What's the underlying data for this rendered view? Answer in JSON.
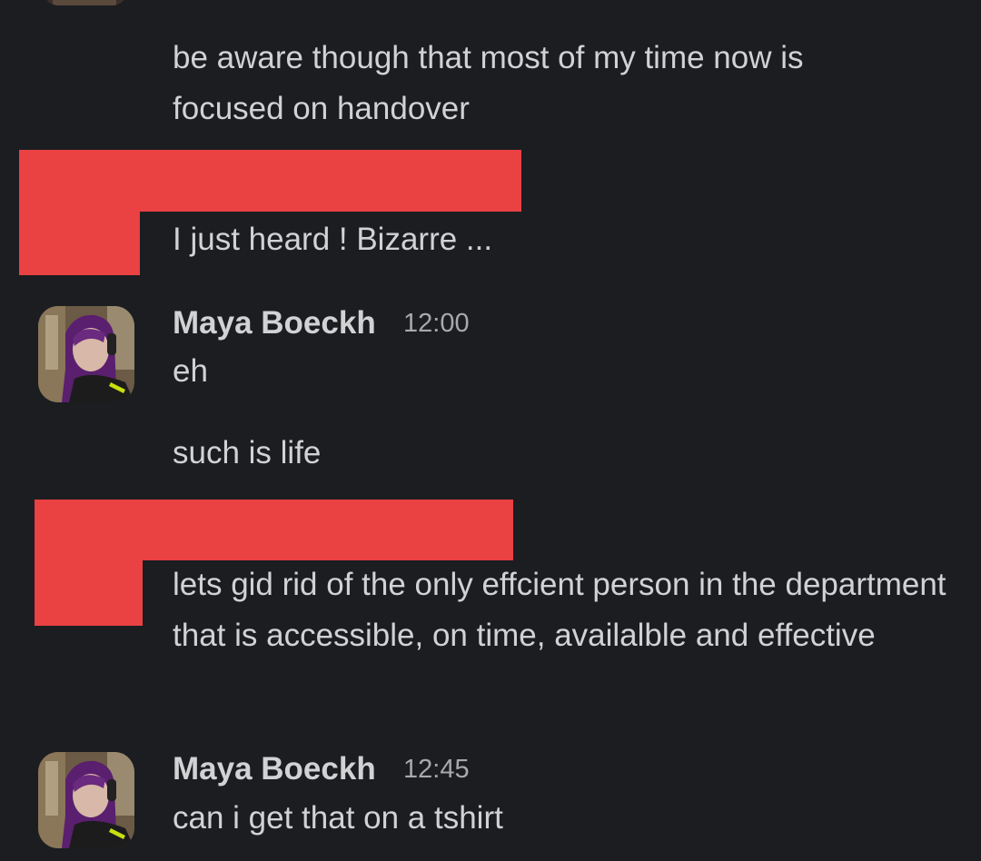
{
  "messages": {
    "m1": "be aware though that most of my time now is focused on handover",
    "m2": "I just heard ! Bizarre ...",
    "m3_author": "Maya Boeckh",
    "m3_time": "12:00",
    "m3": "eh",
    "m4": "such is life",
    "m5": "lets gid rid of the only effcient person in the department that is accessible, on time, availalble and effective",
    "m6_author": "Maya Boeckh",
    "m6_time": "12:45",
    "m6": "can i get that on a tshirt"
  },
  "colors": {
    "background": "#1b1d21",
    "text": "#d1d2d3",
    "timestamp": "#a8a9ab",
    "redaction": "#ea4143"
  },
  "icons": [
    "avatar-photo",
    "redaction-block"
  ]
}
